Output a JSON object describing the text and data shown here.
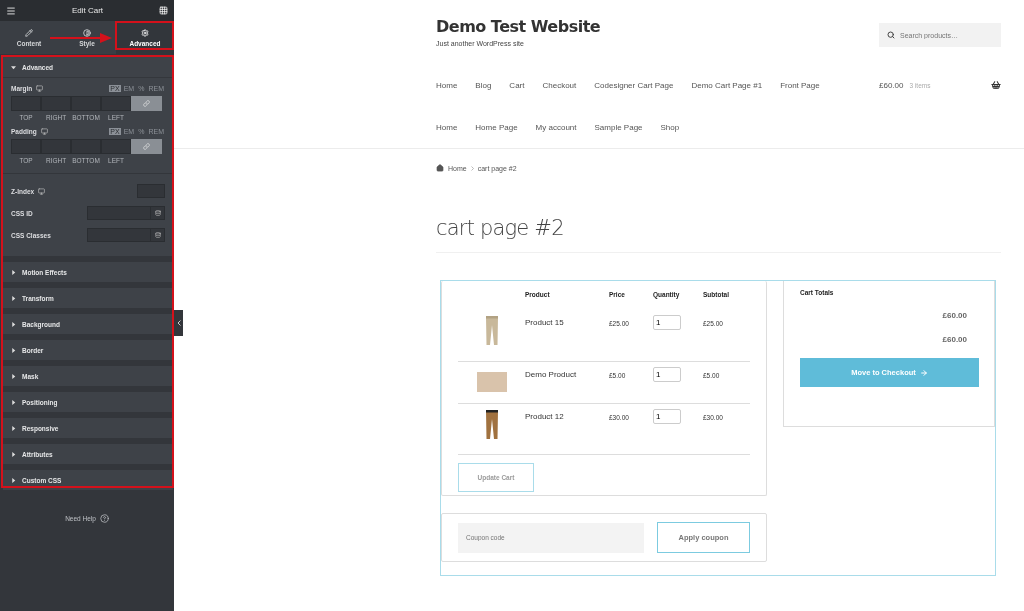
{
  "editor": {
    "title": "Edit Cart",
    "tabs": [
      {
        "label": "Content",
        "selected": false
      },
      {
        "label": "Style",
        "selected": false
      },
      {
        "label": "Advanced",
        "selected": true
      }
    ],
    "sections": [
      {
        "title": "Advanced",
        "expanded": true,
        "spacing": [
          {
            "label": "Margin",
            "units": [
              {
                "label": "PX",
                "selected": true
              },
              {
                "label": "EM",
                "selected": false
              },
              {
                "label": "%",
                "selected": false
              },
              {
                "label": "REM",
                "selected": false
              }
            ],
            "sides": [
              "TOP",
              "RIGHT",
              "BOTTOM",
              "LEFT"
            ]
          },
          {
            "label": "Padding",
            "units": [
              {
                "label": "PX",
                "selected": true
              },
              {
                "label": "EM",
                "selected": false
              },
              {
                "label": "%",
                "selected": false
              },
              {
                "label": "REM",
                "selected": false
              }
            ],
            "sides": [
              "TOP",
              "RIGHT",
              "BOTTOM",
              "LEFT"
            ]
          }
        ],
        "fields": [
          {
            "label": "Z-Index",
            "kind": "number"
          },
          {
            "label": "CSS ID",
            "kind": "text"
          },
          {
            "label": "CSS Classes",
            "kind": "text"
          }
        ]
      },
      {
        "title": "Motion Effects",
        "expanded": false
      },
      {
        "title": "Transform",
        "expanded": false
      },
      {
        "title": "Background",
        "expanded": false
      },
      {
        "title": "Border",
        "expanded": false
      },
      {
        "title": "Mask",
        "expanded": false
      },
      {
        "title": "Positioning",
        "expanded": false
      },
      {
        "title": "Responsive",
        "expanded": false
      },
      {
        "title": "Attributes",
        "expanded": false
      },
      {
        "title": "Custom CSS",
        "expanded": false
      }
    ],
    "help": "Need Help"
  },
  "site": {
    "title": "Demo Test Website",
    "tagline": "Just another WordPress site",
    "search": {
      "placeholder": "Search products…"
    },
    "menu_primary": [
      "Home",
      "Blog",
      "Cart",
      "Checkout",
      "Codesigner Cart Page",
      "Demo Cart Page #1",
      "Front Page"
    ],
    "cart_summary": {
      "total": "£60.00",
      "count": "3 items"
    },
    "menu_secondary": [
      "Home",
      "Home Page",
      "My account",
      "Sample Page",
      "Shop"
    ]
  },
  "breadcrumb": [
    "Home",
    "cart page #2"
  ],
  "page_title": "cart page #2",
  "cart": {
    "columns": [
      "Product",
      "Price",
      "Quantity",
      "Subtotal"
    ],
    "rows": [
      {
        "product": "Product 15",
        "price": "£25.00",
        "quantity": "1",
        "subtotal": "£25.00"
      },
      {
        "product": "Demo Product",
        "price": "£5.00",
        "quantity": "1",
        "subtotal": "£5.00"
      },
      {
        "product": "Product 12",
        "price": "£30.00",
        "quantity": "1",
        "subtotal": "£30.00"
      }
    ],
    "update_button": {
      "label": "Update Cart",
      "disabled": true
    },
    "coupon": {
      "placeholder": "Coupon code",
      "button": "Apply coupon"
    },
    "totals": {
      "title": "Cart Totals",
      "values": [
        "£60.00",
        "£60.00"
      ],
      "checkout_button": "Move to Checkout"
    }
  }
}
